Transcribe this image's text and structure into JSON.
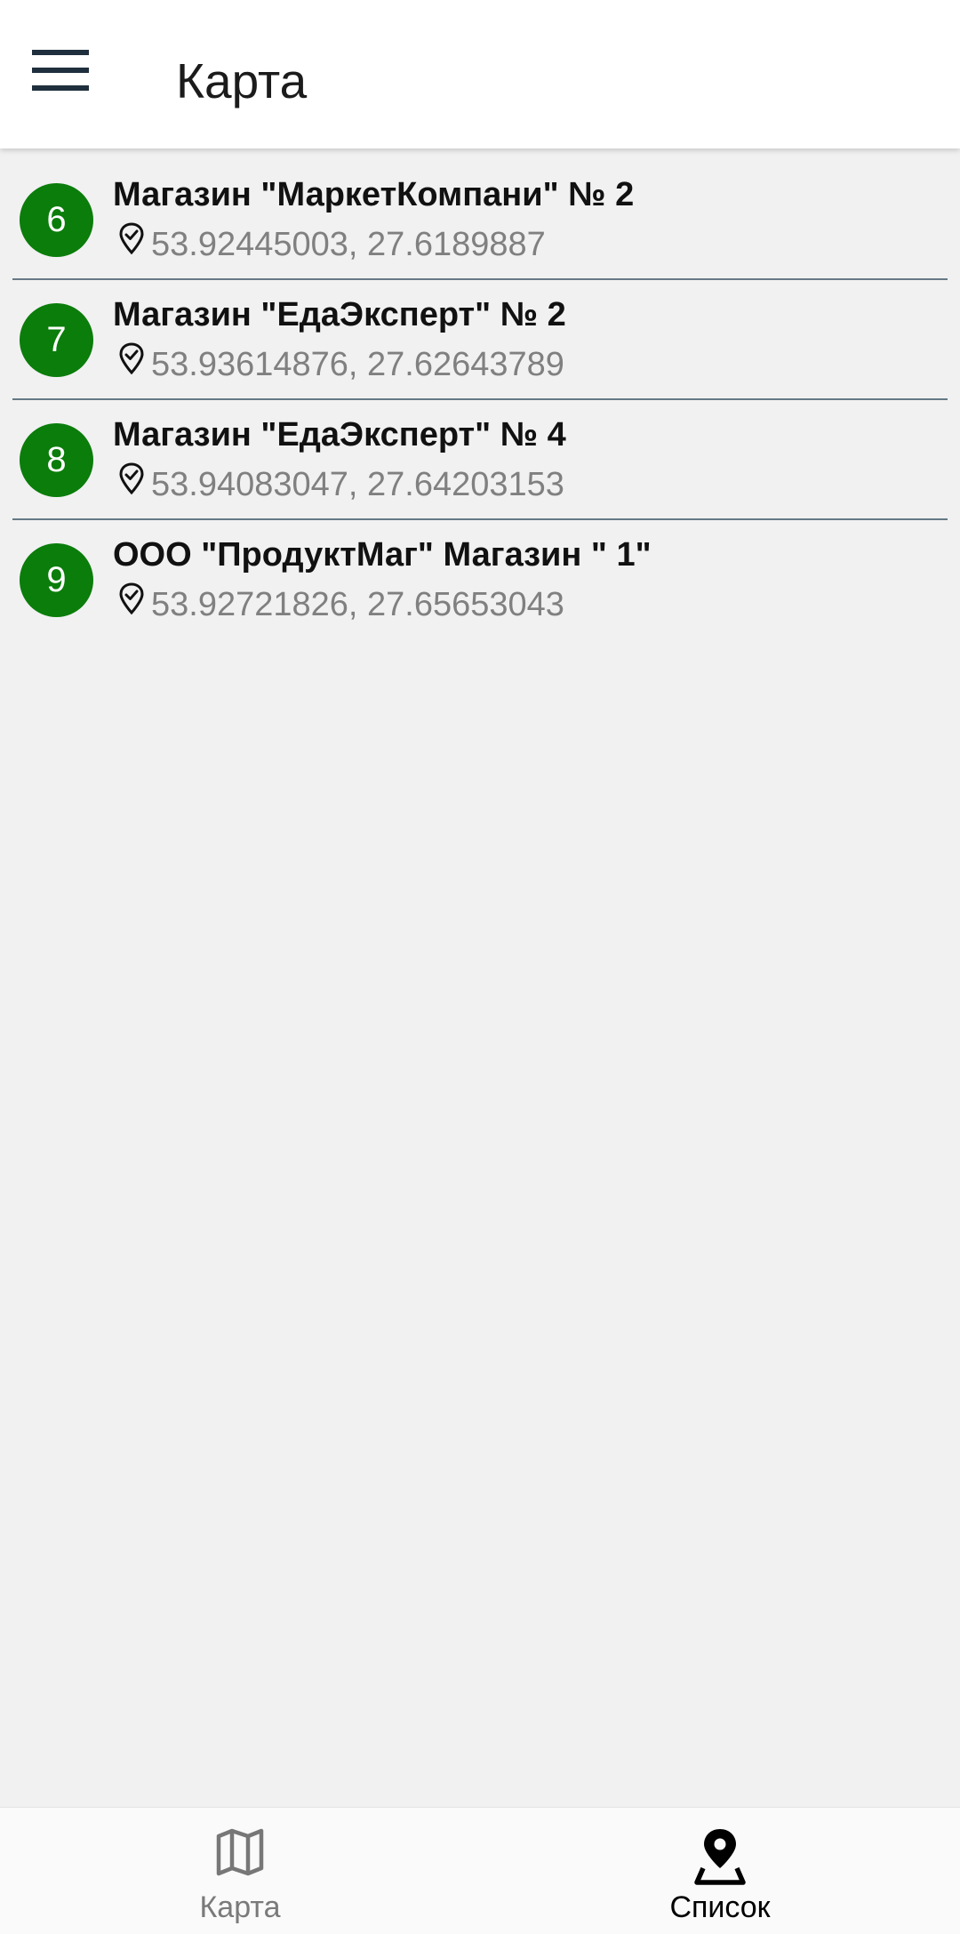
{
  "header": {
    "title": "Карта",
    "menu_icon": "hamburger-menu-icon"
  },
  "colors": {
    "badge": "#0a7d0a",
    "divider": "#667985",
    "background": "#f1f1f1",
    "header_bg": "#ffffff",
    "coords_text": "#808080",
    "nav_inactive": "#7a7a7a",
    "nav_active": "#000000"
  },
  "stores": [
    {
      "number": "6",
      "name": "Магазин \"МаркетКомпани\" № 2",
      "coords": "53.92445003, 27.6189887",
      "pin_icon": "location-pin-icon"
    },
    {
      "number": "7",
      "name": "Магазин \"ЕдаЭксперт\" № 2",
      "coords": "53.93614876, 27.62643789",
      "pin_icon": "location-pin-icon"
    },
    {
      "number": "8",
      "name": "Магазин \"ЕдаЭксперт\" № 4",
      "coords": "53.94083047, 27.64203153",
      "pin_icon": "location-pin-icon"
    },
    {
      "number": "9",
      "name": "ООО \"ПродуктМаг\" Магазин \" 1\"",
      "coords": "53.92721826, 27.65653043",
      "pin_icon": "location-pin-icon"
    }
  ],
  "bottom_nav": {
    "items": [
      {
        "label": "Карта",
        "icon": "map-icon",
        "active": false
      },
      {
        "label": "Список",
        "icon": "map-marker-icon",
        "active": true
      }
    ]
  }
}
